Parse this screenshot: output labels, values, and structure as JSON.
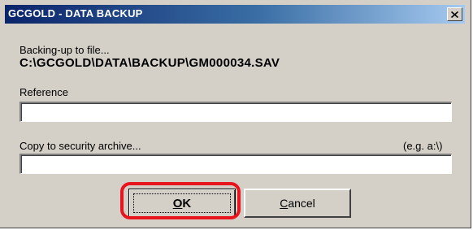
{
  "window": {
    "title": "GCGOLD - DATA BACKUP",
    "close_icon": "close-icon"
  },
  "backup": {
    "status_label": "Backing-up to file...",
    "file_path": "C:\\GCGOLD\\DATA\\BACKUP\\GM000034.SAV"
  },
  "reference": {
    "label": "Reference",
    "value": ""
  },
  "archive": {
    "label": "Copy to security archive...",
    "hint": "(e.g. a:\\)",
    "value": ""
  },
  "buttons": {
    "ok_label": "OK",
    "cancel_label": "Cancel"
  },
  "colors": {
    "dialog_bg": "#d4d0c8",
    "titlebar_start": "#0a246a",
    "titlebar_end": "#a6caf0",
    "highlight": "#e8141e"
  }
}
